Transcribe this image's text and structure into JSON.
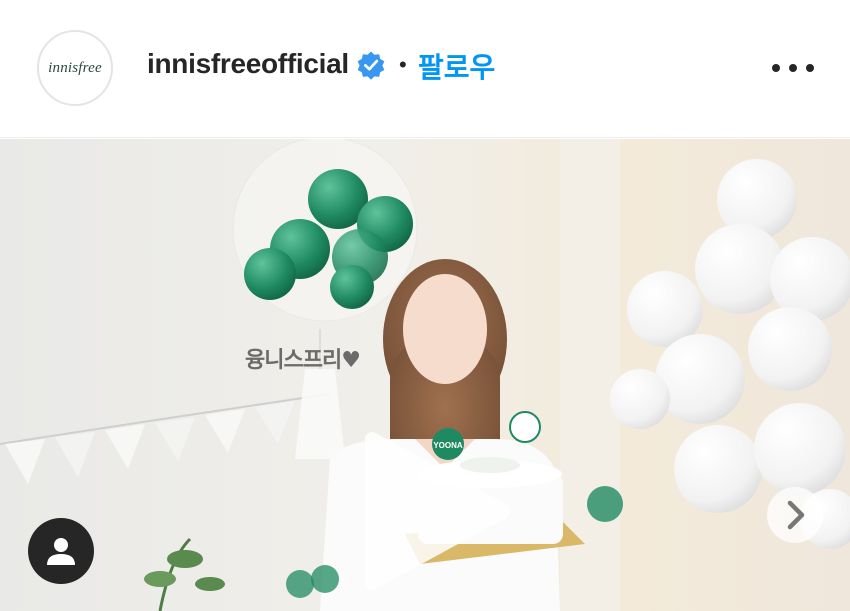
{
  "post": {
    "avatar_text": "innisfree",
    "username": "innisfreeofficial",
    "separator": "•",
    "follow_label": "팔로우"
  },
  "media": {
    "balloon_text": "융니스프리♥",
    "badge_text": "YOONA"
  },
  "icons": {
    "verified": "verified-badge-icon",
    "more": "more-options-icon",
    "play": "play-icon",
    "next": "chevron-right-icon",
    "user": "person-icon"
  },
  "colors": {
    "follow": "#0095f6",
    "verified": "#3897f0",
    "balloon_green": "#1f8a62"
  }
}
